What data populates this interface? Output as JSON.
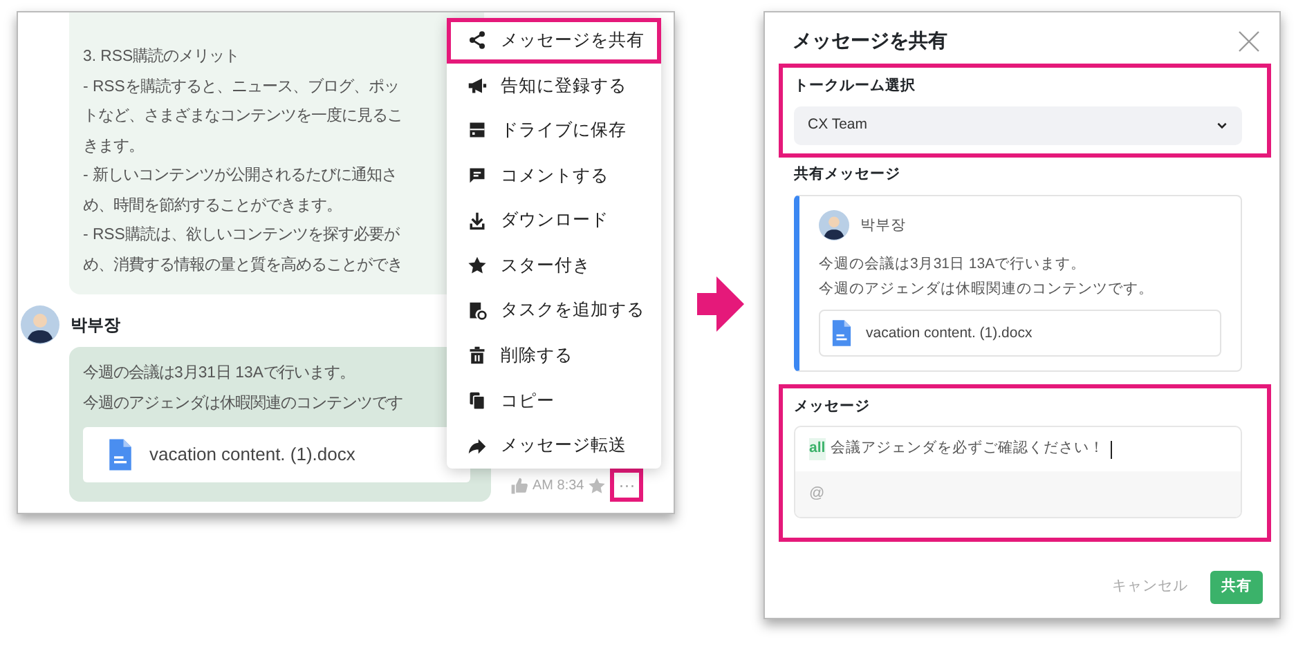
{
  "chat": {
    "previous_message": {
      "lines": [
        "3. RSS購読のメリット",
        "- RSSを購読すると、ニュース、ブログ、ポッ",
        "トなど、さまざまなコンテンツを一度に見るこ",
        "きます。",
        "- 新しいコンテンツが公開されるたびに通知さ",
        "め、時間を節約することができます。",
        "- RSS購読は、欲しいコンテンツを探す必要が",
        "め、消費する情報の量と質を高めることができ"
      ]
    },
    "message": {
      "author": "박부장",
      "lines": [
        "今週の会議は3月31日 13Aで行います。",
        "今週のアジェンダは休暇関連のコンテンツです"
      ],
      "attachment": {
        "file_name": "vacation content. (1).docx"
      },
      "time": "AM 8:34"
    },
    "more_button": {
      "label": "···",
      "highlighted": true
    },
    "context_menu": {
      "items": [
        {
          "label": "メッセージを共有",
          "highlighted": true
        },
        {
          "label": "告知に登録する",
          "highlighted": false
        },
        {
          "label": "ドライブに保存",
          "highlighted": false
        },
        {
          "label": "コメントする",
          "highlighted": false
        },
        {
          "label": "ダウンロード",
          "highlighted": false
        },
        {
          "label": "スター付き",
          "highlighted": false
        },
        {
          "label": "タスクを追加する",
          "highlighted": false
        },
        {
          "label": "削除する",
          "highlighted": false
        },
        {
          "label": "コピー",
          "highlighted": false
        },
        {
          "label": "メッセージ転送",
          "highlighted": false
        }
      ]
    }
  },
  "share_dialog": {
    "title": "メッセージを共有",
    "room_select": {
      "label": "トークルーム選択",
      "value": "CX Team",
      "highlighted": true
    },
    "shared_message": {
      "label": "共有メッセージ",
      "author": "박부장",
      "lines": [
        "今週の会議は3月31日 13Aで行います。",
        "今週のアジェンダは休暇関連のコンテンツです。"
      ],
      "attachment": {
        "file_name": "vacation content. (1).docx"
      },
      "highlighted": false
    },
    "message": {
      "label": "メッセージ",
      "mention_tag": "all",
      "value": "会議アジェンダを必ずご確認ください！",
      "placeholder": "@",
      "highlighted": true
    },
    "buttons": [
      {
        "label": "キャンセル",
        "kind": "secondary"
      },
      {
        "label": "共有",
        "kind": "primary"
      }
    ]
  }
}
